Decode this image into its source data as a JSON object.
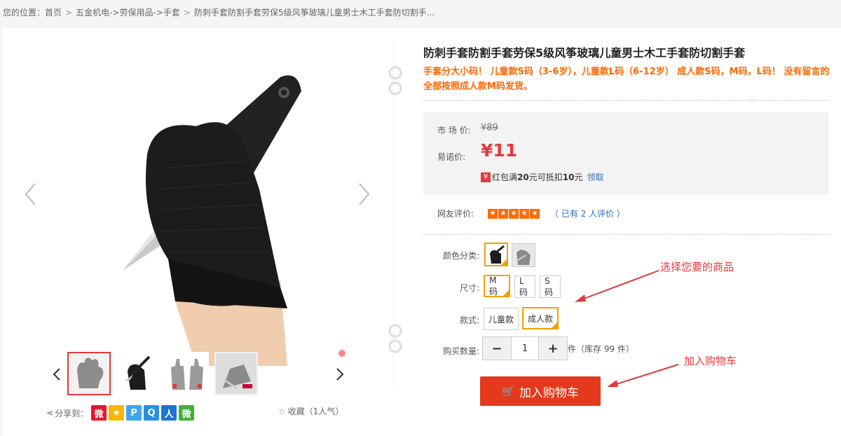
{
  "breadcrumb": {
    "prefix": "您的位置：",
    "items": [
      "首页",
      "五金机电->劳保用品->手套",
      "防刺手套防割手套劳保5级风筝玻璃儿童男士木工手套防切割手..."
    ]
  },
  "product": {
    "title": "防刺手套防割手套劳保5级风筝玻璃儿童男士木工手套防切割手套",
    "promo": "手套分大小码！ 儿童款S码（3-6岁），儿童款L码（6-12岁） 成人款S码，M码，L码！ 没有留言的全部按照成人款M码发货。"
  },
  "price": {
    "market_label": "市 场 价:",
    "market_value": "¥89",
    "sale_label": "易诺价:",
    "sale_value": "¥11",
    "coupon_icon": "¥",
    "coupon_pre": "红包满",
    "coupon_min": "20",
    "coupon_mid": "元可抵扣",
    "coupon_off": "10",
    "coupon_post": "元",
    "coupon_link": "领取"
  },
  "rating": {
    "label": "网友评价:",
    "stars": 5,
    "review_text": "（ 已有 2 人评价 ）"
  },
  "options": {
    "color_label": "颜色分类:",
    "size_label": "尺寸:",
    "sizes": [
      "M码",
      "L码",
      "S码"
    ],
    "style_label": "款式:",
    "styles": [
      "儿童款",
      "成人款"
    ],
    "qty_label": "购买数量:",
    "qty_minus": "−",
    "qty_value": "1",
    "qty_plus": "+",
    "stock_text": "件（库存 99 件）"
  },
  "cart": {
    "label": "加入购物车",
    "icon": "cart-icon"
  },
  "share": {
    "label": "分享到：",
    "icons": [
      "weibo-icon",
      "qzone-icon",
      "pengyou-icon",
      "qq-icon",
      "renren-icon",
      "wechat-icon"
    ]
  },
  "favorite": {
    "star": "☆",
    "label": "收藏",
    "count": "（1人气）"
  },
  "annotations": {
    "select": "选择您要的商品",
    "add_cart": "加入购物车"
  },
  "colors": {
    "accent": "#e4393c",
    "promo": "#ff6600",
    "selected_border": "#f0a000",
    "link": "#2a6db3"
  }
}
